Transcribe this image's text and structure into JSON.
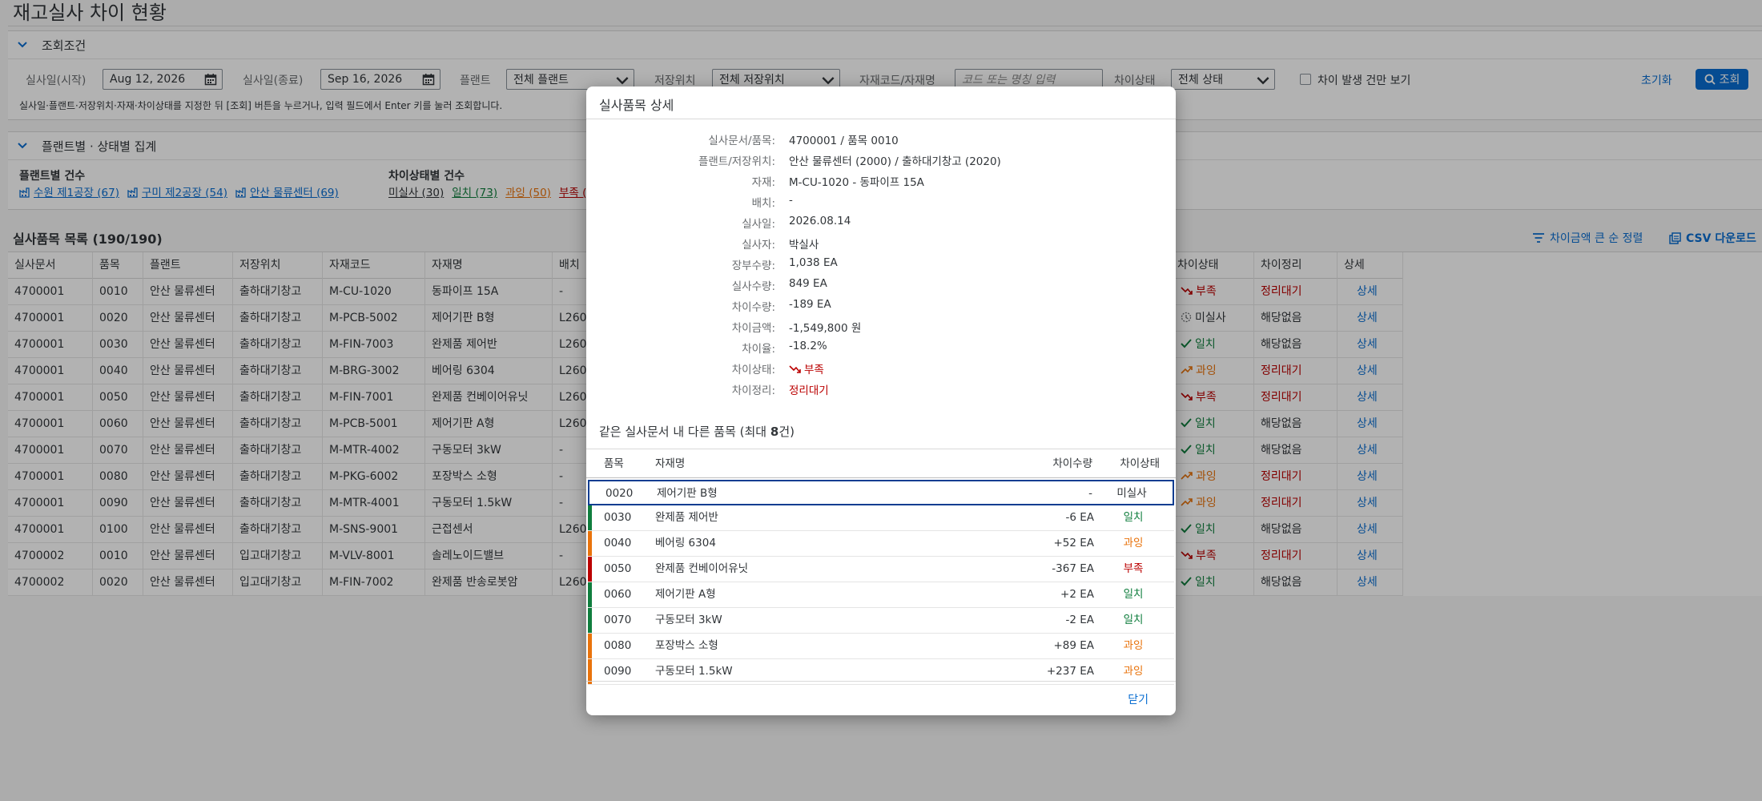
{
  "page": {
    "title": "재고실사 차이 현황"
  },
  "filters": {
    "section_title": "조회조건",
    "start_label": "실사일(시작)",
    "start_value": "Aug 12, 2026",
    "end_label": "실사일(종료)",
    "end_value": "Sep 16, 2026",
    "plant_label": "플랜트",
    "plant_value": "전체 플랜트",
    "sloc_label": "저장위치",
    "sloc_value": "전체 저장위치",
    "material_label": "자재코드/자재명",
    "material_placeholder": "코드 또는 명칭 입력",
    "status_label": "차이상태",
    "status_value": "전체 상태",
    "diff_only_label": "차이 발생 건만 보기",
    "reset_label": "초기화",
    "search_label": "조회",
    "hint": "실사일·플랜트·저장위치·자재·차이상태를 지정한 뒤 [조회] 버튼을 누르거나, 입력 필드에서 Enter 키를 눌러 조회합니다."
  },
  "summary": {
    "section_title": "플랜트별 · 상태별 집계",
    "plant_count_label": "플랜트별 건수",
    "plants": [
      "수원 제1공장 (67)",
      "구미 제2공장 (54)",
      "안산 물류센터 (69)"
    ],
    "status_count_label": "차이상태별 건수",
    "statuses": [
      "미실사 (30)",
      "일치 (73)",
      "과잉 (50)",
      "부족 ("
    ]
  },
  "list": {
    "title": "실사품목 목록 (190/190)",
    "sort_label": "차이금액 큰 순 정렬",
    "csv_label": "CSV 다운로드",
    "columns": [
      "실사문서",
      "품목",
      "플랜트",
      "저장위치",
      "자재코드",
      "자재명",
      "배치",
      "차이상태",
      "차이정리",
      "상세"
    ],
    "rows": [
      {
        "doc": "4700001",
        "item": "0010",
        "plant": "안산 물류센터",
        "sloc": "출하대기창고",
        "mat": "M-CU-1020",
        "name": "동파이프 15A",
        "batch": "-",
        "status": "부족",
        "status_type": "bad",
        "settle": "정리대기",
        "detail": "상세"
      },
      {
        "doc": "4700001",
        "item": "0020",
        "plant": "안산 물류센터",
        "sloc": "출하대기창고",
        "mat": "M-PCB-5002",
        "name": "제어기판 B형",
        "batch": "L260",
        "status": "미실사",
        "status_type": "none",
        "settle": "해당없음",
        "detail": "상세"
      },
      {
        "doc": "4700001",
        "item": "0030",
        "plant": "안산 물류센터",
        "sloc": "출하대기창고",
        "mat": "M-FIN-7003",
        "name": "완제품 제어반",
        "batch": "L260",
        "status": "일치",
        "status_type": "ok",
        "settle": "해당없음",
        "detail": "상세"
      },
      {
        "doc": "4700001",
        "item": "0040",
        "plant": "안산 물류센터",
        "sloc": "출하대기창고",
        "mat": "M-BRG-3002",
        "name": "베어링 6304",
        "batch": "L260",
        "status": "과잉",
        "status_type": "over",
        "settle": "정리대기",
        "detail": "상세"
      },
      {
        "doc": "4700001",
        "item": "0050",
        "plant": "안산 물류센터",
        "sloc": "출하대기창고",
        "mat": "M-FIN-7001",
        "name": "완제품 컨베이어유닛",
        "batch": "L260",
        "status": "부족",
        "status_type": "bad",
        "settle": "정리대기",
        "detail": "상세"
      },
      {
        "doc": "4700001",
        "item": "0060",
        "plant": "안산 물류센터",
        "sloc": "출하대기창고",
        "mat": "M-PCB-5001",
        "name": "제어기판 A형",
        "batch": "L260",
        "status": "일치",
        "status_type": "ok",
        "settle": "해당없음",
        "detail": "상세"
      },
      {
        "doc": "4700001",
        "item": "0070",
        "plant": "안산 물류센터",
        "sloc": "출하대기창고",
        "mat": "M-MTR-4002",
        "name": "구동모터 3kW",
        "batch": "-",
        "status": "일치",
        "status_type": "ok",
        "settle": "해당없음",
        "detail": "상세"
      },
      {
        "doc": "4700001",
        "item": "0080",
        "plant": "안산 물류센터",
        "sloc": "출하대기창고",
        "mat": "M-PKG-6002",
        "name": "포장박스 소형",
        "batch": "-",
        "status": "과잉",
        "status_type": "over",
        "settle": "정리대기",
        "detail": "상세"
      },
      {
        "doc": "4700001",
        "item": "0090",
        "plant": "안산 물류센터",
        "sloc": "출하대기창고",
        "mat": "M-MTR-4001",
        "name": "구동모터 1.5kW",
        "batch": "-",
        "status": "과잉",
        "status_type": "over",
        "settle": "정리대기",
        "detail": "상세"
      },
      {
        "doc": "4700001",
        "item": "0100",
        "plant": "안산 물류센터",
        "sloc": "출하대기창고",
        "mat": "M-SNS-9001",
        "name": "근접센서",
        "batch": "L260",
        "status": "일치",
        "status_type": "ok",
        "settle": "해당없음",
        "detail": "상세"
      },
      {
        "doc": "4700002",
        "item": "0010",
        "plant": "안산 물류센터",
        "sloc": "입고대기창고",
        "mat": "M-VLV-8001",
        "name": "솔레노이드밸브",
        "batch": "-",
        "status": "부족",
        "status_type": "bad",
        "settle": "정리대기",
        "detail": "상세"
      },
      {
        "doc": "4700002",
        "item": "0020",
        "plant": "안산 물류센터",
        "sloc": "입고대기창고",
        "mat": "M-FIN-7002",
        "name": "완제품 반송로봇암",
        "batch": "L260",
        "status": "일치",
        "status_type": "ok",
        "settle": "해당없음",
        "detail": "상세"
      }
    ]
  },
  "dialog": {
    "title": "실사품목 상세",
    "fields": [
      {
        "label": "실사문서/품목:",
        "value": "4700001 / 품목 0010"
      },
      {
        "label": "플랜트/저장위치:",
        "value": "안산 물류센터 (2000) / 출하대기창고 (2020)"
      },
      {
        "label": "자재:",
        "value": "M-CU-1020 - 동파이프 15A"
      },
      {
        "label": "배치:",
        "value": "-"
      },
      {
        "label": "실사일:",
        "value": "2026.08.14"
      },
      {
        "label": "실사자:",
        "value": "박실사"
      },
      {
        "label": "장부수량:",
        "value": "1,038 EA"
      },
      {
        "label": "실사수량:",
        "value": "849 EA"
      },
      {
        "label": "차이수량:",
        "value": "-189 EA"
      },
      {
        "label": "차이금액:",
        "value": "-1,549,800 원"
      },
      {
        "label": "차이율:",
        "value": "-18.2%"
      },
      {
        "label": "차이상태:",
        "value": "부족"
      },
      {
        "label": "차이정리:",
        "value": "정리대기"
      }
    ],
    "sub_title_prefix": "같은 실사문서 내 다른 품목 (",
    "sub_title_bold_a": "최대 ",
    "sub_title_bold_b": "8",
    "sub_title_suffix": "건)",
    "sub_columns": [
      "품목",
      "자재명",
      "차이수량",
      "차이상태"
    ],
    "sub_rows": [
      {
        "item": "0020",
        "name": "제어기판 B형",
        "qty": "-",
        "status": "미실사",
        "status_type": "none"
      },
      {
        "item": "0030",
        "name": "완제품 제어반",
        "qty": "-6 EA",
        "status": "일치",
        "status_type": "ok"
      },
      {
        "item": "0040",
        "name": "베어링 6304",
        "qty": "+52 EA",
        "status": "과잉",
        "status_type": "over"
      },
      {
        "item": "0050",
        "name": "완제품 컨베이어유닛",
        "qty": "-367 EA",
        "status": "부족",
        "status_type": "bad"
      },
      {
        "item": "0060",
        "name": "제어기판 A형",
        "qty": "+2 EA",
        "status": "일치",
        "status_type": "ok"
      },
      {
        "item": "0070",
        "name": "구동모터 3kW",
        "qty": "-2 EA",
        "status": "일치",
        "status_type": "ok"
      },
      {
        "item": "0080",
        "name": "포장박스 소형",
        "qty": "+89 EA",
        "status": "과잉",
        "status_type": "over"
      },
      {
        "item": "0090",
        "name": "구동모터 1.5kW",
        "qty": "+237 EA",
        "status": "과잉",
        "status_type": "over"
      }
    ],
    "close_label": "닫기"
  },
  "colors": {
    "accent": "#0a6ed1",
    "bad": "#bb0000",
    "ok": "#107e3e",
    "over": "#e9730c",
    "selected_border": "#0a3d91"
  }
}
